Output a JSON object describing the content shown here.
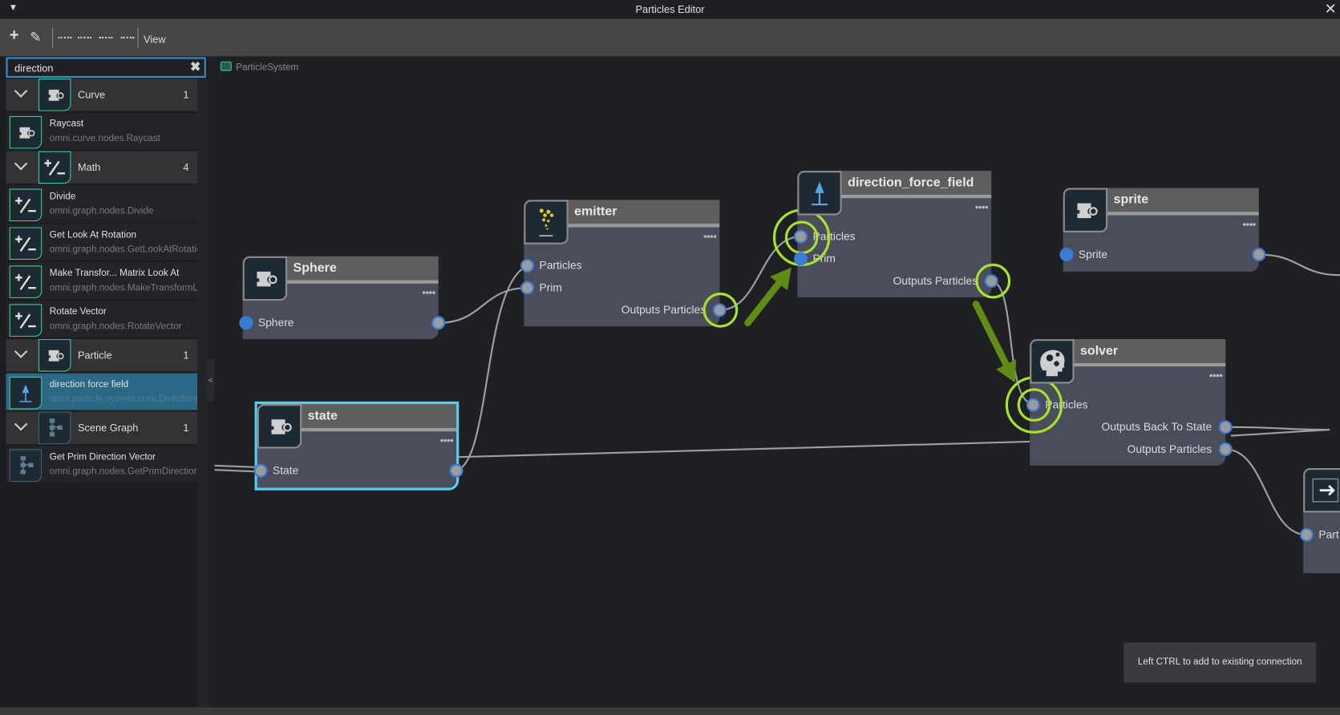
{
  "window": {
    "title": "Particles Editor"
  },
  "toolbar": {
    "view_label": "View"
  },
  "search": {
    "value": "direction"
  },
  "breadcrumb": {
    "label": "ParticleSystem"
  },
  "sidebar": {
    "categories": [
      {
        "label": "Curve",
        "count": "1",
        "icon": "prim-icon",
        "items": [
          {
            "name": "Raycast",
            "id": "omni.curve.nodes.Raycast",
            "icon": "prim-icon"
          }
        ]
      },
      {
        "label": "Math",
        "count": "4",
        "icon": "plus-minus-icon",
        "items": [
          {
            "name": "Divide",
            "id": "omni.graph.nodes.Divide",
            "icon": "plus-minus-icon"
          },
          {
            "name": "Get Look At Rotation",
            "id": "omni.graph.nodes.GetLookAtRotation",
            "icon": "plus-minus-icon"
          },
          {
            "name": "Make Transfor... Matrix Look At",
            "id": "omni.graph.nodes.MakeTransformLookAt",
            "icon": "plus-minus-icon"
          },
          {
            "name": "Rotate Vector",
            "id": "omni.graph.nodes.RotateVector",
            "icon": "plus-minus-icon"
          }
        ]
      },
      {
        "label": "Particle",
        "count": "1",
        "icon": "prim-icon",
        "items": [
          {
            "name": "direction force field",
            "id": "omni.particle.system.core.DirectionForceField",
            "icon": "direction-arrow-icon",
            "selected": true
          }
        ]
      },
      {
        "label": "Scene Graph",
        "count": "1",
        "icon": "hierarchy-icon",
        "items": [
          {
            "name": "Get Prim Direction Vector",
            "id": "omni.graph.nodes.GetPrimDirectionVector",
            "icon": "hierarchy-icon"
          }
        ]
      }
    ]
  },
  "graph": {
    "nodes": [
      {
        "key": "sphere",
        "title": "Sphere",
        "icon": "prim-icon",
        "inputs": [
          {
            "label": "Sphere",
            "bundle": true
          }
        ],
        "outputs": [
          {
            "label": ""
          }
        ]
      },
      {
        "key": "emitter",
        "title": "emitter",
        "icon": "emitter-icon",
        "inputs": [
          {
            "label": "Particles"
          },
          {
            "label": "Prim"
          }
        ],
        "outputs": [
          {
            "label": "Outputs Particles"
          }
        ]
      },
      {
        "key": "dff",
        "title": "direction_force_field",
        "icon": "direction-arrow-icon",
        "inputs": [
          {
            "label": "Particles"
          },
          {
            "label": "Prim",
            "bundle": true
          }
        ],
        "outputs": [
          {
            "label": "Outputs Particles"
          }
        ]
      },
      {
        "key": "sprite",
        "title": "sprite",
        "icon": "prim-icon",
        "inputs": [
          {
            "label": "Sprite",
            "bundle": true
          }
        ],
        "outputs": [
          {
            "label": ""
          }
        ]
      },
      {
        "key": "solver",
        "title": "solver",
        "icon": "head-gears-icon",
        "inputs": [
          {
            "label": "Particles"
          }
        ],
        "outputs": [
          {
            "label": "Outputs Back To State"
          },
          {
            "label": "Outputs Particles"
          }
        ]
      },
      {
        "key": "state",
        "title": "state",
        "icon": "prim-icon",
        "selected": true,
        "inputs": [
          {
            "label": "State"
          }
        ],
        "outputs": [
          {
            "label": ""
          }
        ]
      },
      {
        "key": "output",
        "title": "",
        "icon": "arrow-right-icon",
        "inputs": [
          {
            "label": "Part"
          }
        ],
        "outputs": []
      }
    ],
    "highlight_color": "#a6e22e",
    "arrow_color": "#5f8c14",
    "selection_color": "#57cdf2"
  },
  "tooltip": {
    "text": "Left CTRL to add to existing connection"
  }
}
